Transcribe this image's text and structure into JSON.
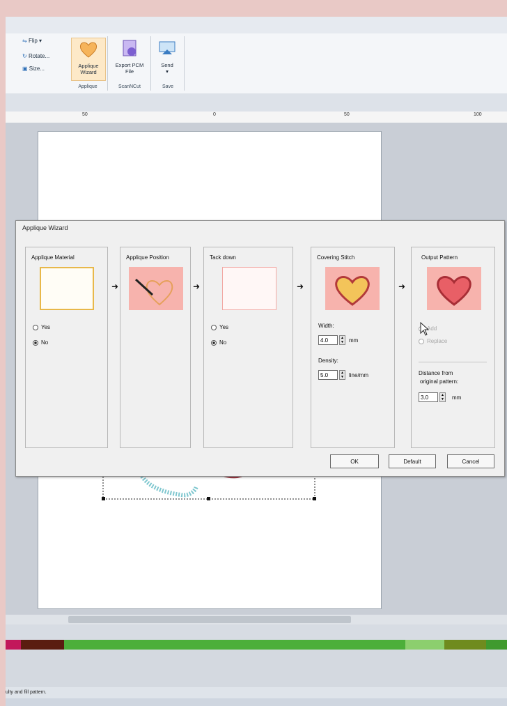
{
  "ribbon": {
    "small_buttons": [
      "Flip",
      "Rotate...",
      "Size..."
    ],
    "groups": [
      {
        "label": "Applique",
        "buttons": [
          {
            "label": "Applique Wizard"
          }
        ]
      },
      {
        "label": "ScanNCut",
        "buttons": [
          {
            "label": "Export PCM File"
          }
        ]
      },
      {
        "label": "Save",
        "buttons": [
          {
            "label": "Send"
          }
        ]
      }
    ]
  },
  "ruler": {
    "ticks": [
      "50",
      "0",
      "50",
      "100"
    ]
  },
  "dialog": {
    "title": "Applique Wizard",
    "panels": [
      {
        "title": "Applique Material",
        "options": [
          "Yes",
          "No"
        ],
        "selected": "No"
      },
      {
        "title": "Applique Position"
      },
      {
        "title": "Tack down",
        "options": [
          "Yes",
          "No"
        ],
        "selected": "No"
      },
      {
        "title": "Covering Stitch",
        "width_label": "Width:",
        "width_value": "4.0",
        "width_unit": "mm",
        "density_label": "Density:",
        "density_value": "5.0",
        "density_unit": "line/mm"
      },
      {
        "title": "Output Pattern",
        "options": [
          "Add",
          "Replace"
        ],
        "distance_label_1": "Distance from",
        "distance_label_2": "original pattern:",
        "distance_value": "3.0",
        "distance_unit": "mm"
      }
    ],
    "buttons": {
      "ok": "OK",
      "default": "Default",
      "cancel": "Cancel"
    }
  },
  "status": {
    "text": "ulty and fill pattern."
  },
  "colors": {
    "accent_pink": "#f7b3ad",
    "heart_gold": "#f2c15a",
    "heart_red": "#e4555c"
  }
}
